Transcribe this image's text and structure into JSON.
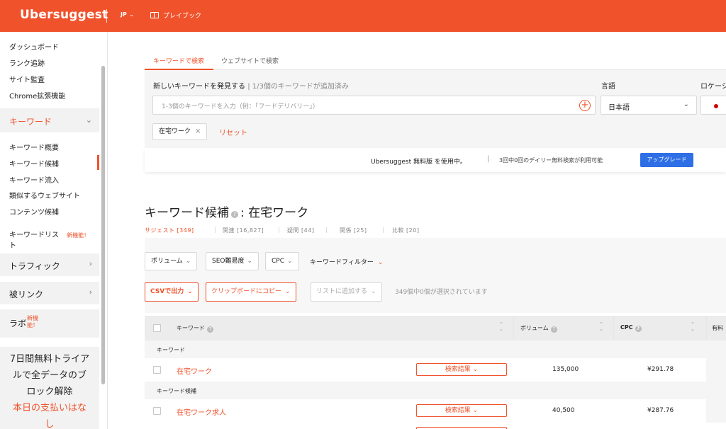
{
  "header": {
    "logo": "Ubersuggest",
    "lang": "JP",
    "playbook": "プレイブック"
  },
  "sidebar": {
    "items": [
      "ダッシュボード",
      "ランク追跡",
      "サイト監査",
      "Chrome拡張機能"
    ],
    "keyword_section": "キーワード",
    "keyword_items": [
      "キーワード概要",
      "キーワード候補",
      "キーワード流入",
      "類似するウェブサイト",
      "コンテンツ候補"
    ],
    "keyword_list_line1": "キーワードリス",
    "keyword_list_line2": "ト",
    "new_feature": "新機能！",
    "traffic": "トラフィック",
    "backlinks": "被リンク",
    "labs": "ラボ",
    "labs_new_line1": "新機",
    "labs_new_line2": "能！",
    "promo_line1": "7日間無料トライア",
    "promo_line2": "ルで全データのブ",
    "promo_line3": "ロック解除",
    "promo_line4": "本日の支払いはな",
    "promo_line5": "し"
  },
  "tabs": {
    "keyword_search": "キーワードで検索",
    "website_search": "ウェブサイトで検索"
  },
  "search": {
    "label": "新しいキーワードを発見する",
    "sublabel": "| 1/3個のキーワードが追加済み",
    "placeholder": "1-3個のキーワードを入力（例：「フードデリバリー」）",
    "language_label": "言語",
    "language_value": "日本語",
    "location_label": "ロケーシ",
    "chip": "在宅ワーク",
    "reset": "リセット"
  },
  "upgrade": {
    "text": "Ubersuggest 無料版 を使用中。",
    "sep": "|",
    "count": "3回中0回のデイリー無料検索が利用可能",
    "button": "アップグレード"
  },
  "results": {
    "title_prefix": "キーワード候補",
    "title_suffix": ": 在宅ワーク",
    "subtabs": [
      "サジェスト [349]",
      "関連 [16,827]",
      "疑問 [44]",
      "関係 [25]",
      "比較 [20]"
    ],
    "filters": [
      "ボリューム",
      "SEO難易度",
      "CPC"
    ],
    "keyword_filter": "キーワードフィルター",
    "csv": "CSVで出力",
    "clipboard": "クリップボードにコピー",
    "add_list": "リストに追加する",
    "selected": "349個中0個が選択されています"
  },
  "table": {
    "headers": {
      "keyword": "キーワード",
      "volume": "ボリューム",
      "cpc": "CPC",
      "paid": "有料"
    },
    "group1": "キーワード",
    "group2": "キーワード候補",
    "rows": [
      {
        "keyword": "在宅ワーク",
        "serp": "検索結果",
        "volume": "135,000",
        "cpc": "¥291.78"
      },
      {
        "keyword": "在宅ワーク求人",
        "serp": "検索結果",
        "volume": "40,500",
        "cpc": "¥287.76"
      }
    ]
  },
  "colors": {
    "brand": "#f0522b",
    "upgrade": "#2f6fe6"
  }
}
